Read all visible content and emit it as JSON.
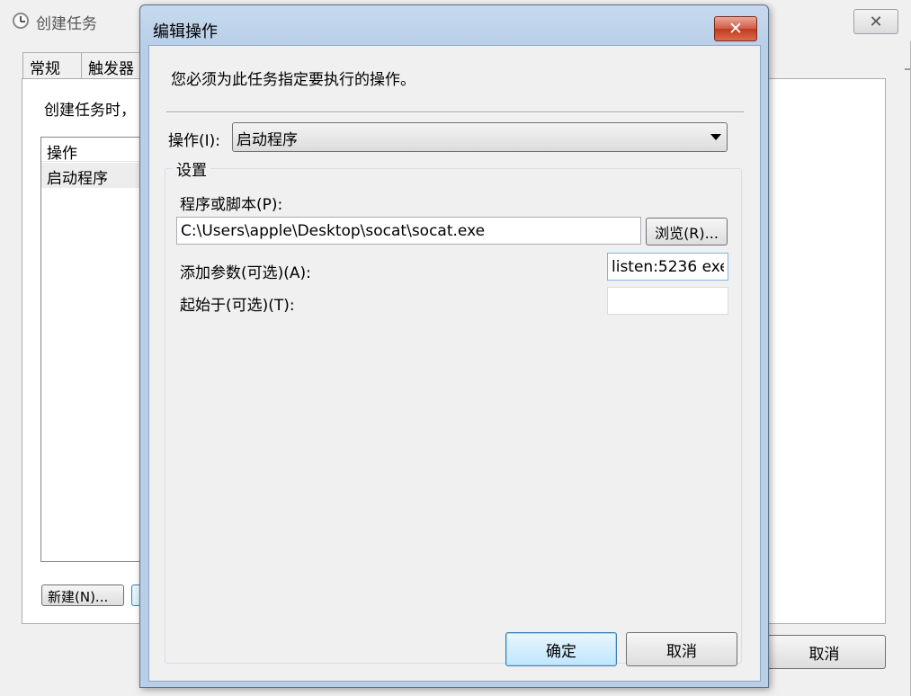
{
  "background_window": {
    "title": "创建任务",
    "close_label": "✕",
    "tabs": [
      {
        "label": "常规"
      },
      {
        "label": "触发器"
      }
    ],
    "description": "创建任务时，",
    "actions_list": {
      "header": "操作",
      "rows": [
        "启动程序"
      ]
    },
    "new_button_label": "新建(N)...",
    "cancel_button_label": "取消"
  },
  "dialog": {
    "title": "编辑操作",
    "close_label": "✕",
    "instruction": "您必须为此任务指定要执行的操作。",
    "action": {
      "label": "操作(I):",
      "selected": "启动程序"
    },
    "settings": {
      "legend": "设置",
      "program_label": "程序或脚本(P):",
      "program_value": "C:\\Users\\apple\\Desktop\\socat\\socat.exe",
      "browse_label": "浏览(R)...",
      "args_label": "添加参数(可选)(A):",
      "args_value": "listen:5236 exe",
      "start_label": "起始于(可选)(T):",
      "start_value": ""
    },
    "ok_label": "确定",
    "cancel_label": "取消"
  }
}
